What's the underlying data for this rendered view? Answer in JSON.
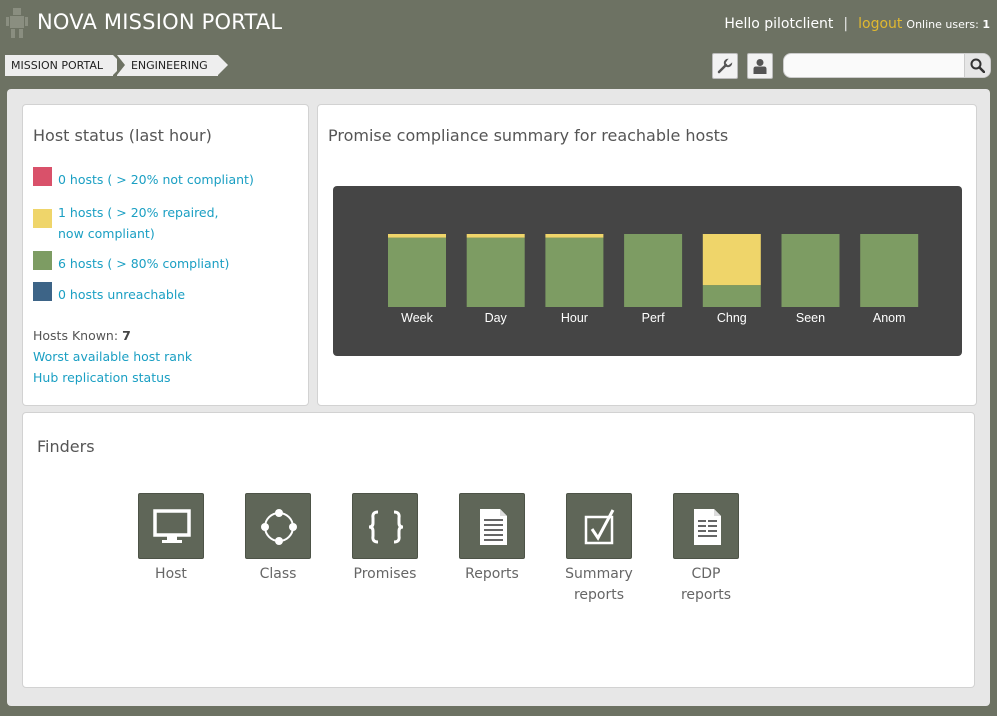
{
  "header": {
    "app_title": "NOVA MISSION PORTAL",
    "greeting": "Hello pilotclient",
    "separator": "|",
    "logout_label": "logout",
    "online_users_label": "Online users:",
    "online_users_count": "1"
  },
  "breadcrumb": [
    "MISSION PORTAL",
    "ENGINEERING"
  ],
  "toolbar": {
    "tools_icon": "wrench-icon",
    "user_icon": "user-icon",
    "search_placeholder": "",
    "search_icon": "search-icon"
  },
  "host_status": {
    "title": "Host status (last hour)",
    "legend": [
      {
        "label": "0 hosts ( > 20% not compliant)",
        "color": "#d9516a"
      },
      {
        "label": "1 hosts ( > 20% repaired, now compliant)",
        "color": "#efd56a"
      },
      {
        "label": "6 hosts ( > 80% compliant)",
        "color": "#7d9c63"
      },
      {
        "label": "0 hosts unreachable",
        "color": "#3d6487"
      }
    ],
    "hosts_known_label": "Hosts Known:",
    "hosts_known_value": "7",
    "worst_rank_link": "Worst available host rank",
    "hub_replication_link": "Hub replication status"
  },
  "compliance": {
    "title": "Promise compliance summary for reachable hosts"
  },
  "chart_data": {
    "type": "bar",
    "stacked": true,
    "categories": [
      "Week",
      "Day",
      "Hour",
      "Perf",
      "Chng",
      "Seen",
      "Anom"
    ],
    "series": [
      {
        "color": "#7d9c63",
        "values": [
          95,
          95,
          95,
          100,
          30,
          100,
          100
        ]
      },
      {
        "color": "#efd56a",
        "values": [
          5,
          5,
          5,
          0,
          70,
          0,
          0
        ]
      }
    ],
    "ylim": [
      0,
      100
    ],
    "grid": false
  },
  "finders": {
    "title": "Finders",
    "items": [
      {
        "label": "Host",
        "icon": "monitor-icon"
      },
      {
        "label": "Class",
        "icon": "class-circle-icon"
      },
      {
        "label": "Promises",
        "icon": "braces-icon"
      },
      {
        "label": "Reports",
        "icon": "document-icon"
      },
      {
        "label": "Summary reports",
        "icon": "checkbox-icon"
      },
      {
        "label": "CDP reports",
        "icon": "document-icon"
      }
    ]
  }
}
